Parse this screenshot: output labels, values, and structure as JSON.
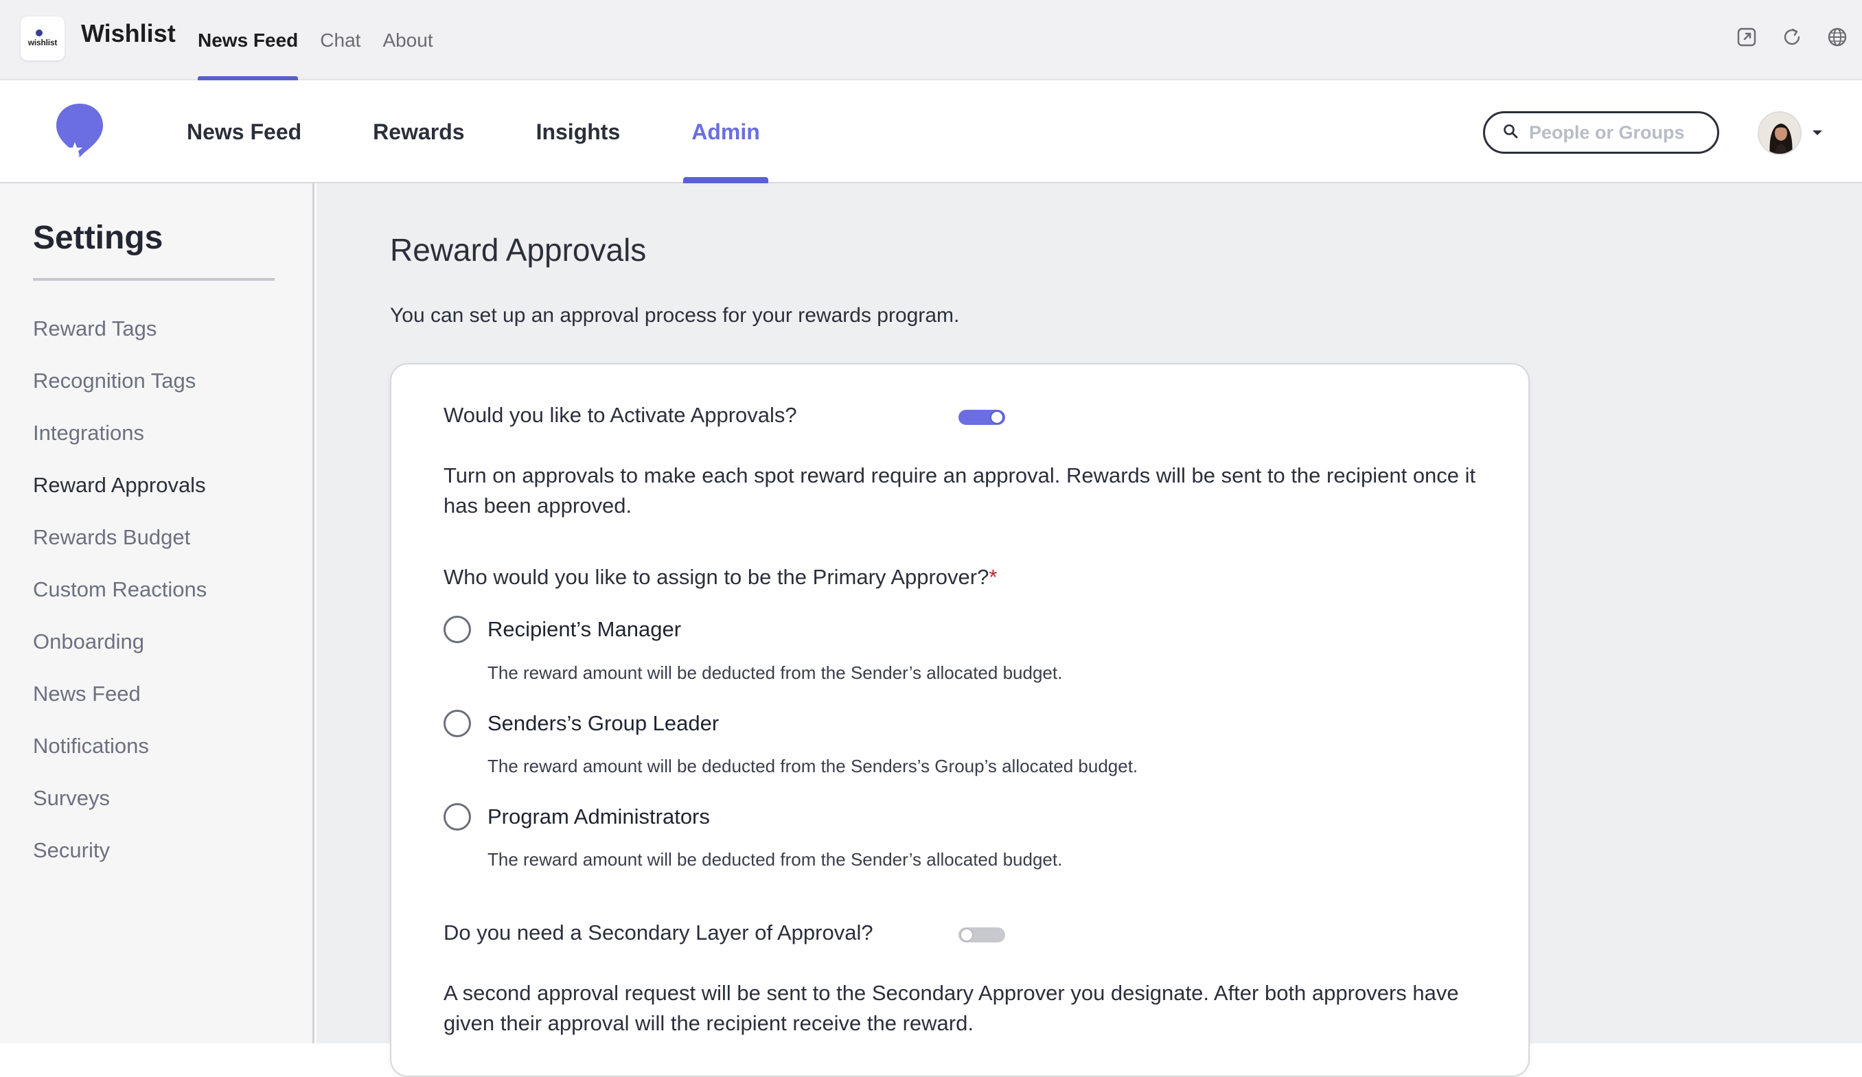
{
  "host": {
    "app_name": "Wishlist",
    "logo_word": "wishlist",
    "tabs": [
      {
        "label": "News Feed",
        "active": true
      },
      {
        "label": "Chat",
        "active": false
      },
      {
        "label": "About",
        "active": false
      }
    ],
    "icons": [
      "popout-icon",
      "refresh-icon",
      "globe-icon"
    ]
  },
  "header": {
    "nav": [
      {
        "label": "News Feed",
        "active": false
      },
      {
        "label": "Rewards",
        "active": false
      },
      {
        "label": "Insights",
        "active": false
      },
      {
        "label": "Admin",
        "active": true
      }
    ],
    "search": {
      "placeholder": "People or Groups",
      "value": ""
    },
    "accent_color": "#5b5fd8"
  },
  "sidebar": {
    "title": "Settings",
    "items": [
      {
        "label": "Reward Tags",
        "active": false
      },
      {
        "label": "Recognition Tags",
        "active": false
      },
      {
        "label": "Integrations",
        "active": false
      },
      {
        "label": "Reward Approvals",
        "active": true
      },
      {
        "label": "Rewards Budget",
        "active": false
      },
      {
        "label": "Custom Reactions",
        "active": false
      },
      {
        "label": "Onboarding",
        "active": false
      },
      {
        "label": "News Feed",
        "active": false
      },
      {
        "label": "Notifications",
        "active": false
      },
      {
        "label": "Surveys",
        "active": false
      },
      {
        "label": "Security",
        "active": false
      }
    ]
  },
  "main": {
    "title": "Reward Approvals",
    "subtitle": "You can set up an approval process for your rewards program.",
    "activate": {
      "question": "Would you like to Activate Approvals?",
      "enabled": true,
      "description": "Turn on approvals to make each spot reward require an approval. Rewards will be sent to the recipient once it has been approved."
    },
    "primary": {
      "question": "Who would you like to assign to be the Primary Approver?",
      "required_mark": "*",
      "options": [
        {
          "label": "Recipient’s Manager",
          "help": "The reward amount will be deducted from the Sender’s allocated budget.",
          "selected": false
        },
        {
          "label": "Senders’s Group Leader",
          "help": "The reward amount will be deducted from the Senders’s Group’s allocated budget.",
          "selected": false
        },
        {
          "label": "Program Administrators",
          "help": "The reward amount will be deducted from the Sender’s allocated budget.",
          "selected": false
        }
      ]
    },
    "secondary": {
      "question": "Do you need a Secondary Layer of Approval?",
      "enabled": false,
      "description": "A second approval request will be sent to the Secondary Approver you designate. After both approvers have given their approval will the recipient receive the reward."
    }
  }
}
